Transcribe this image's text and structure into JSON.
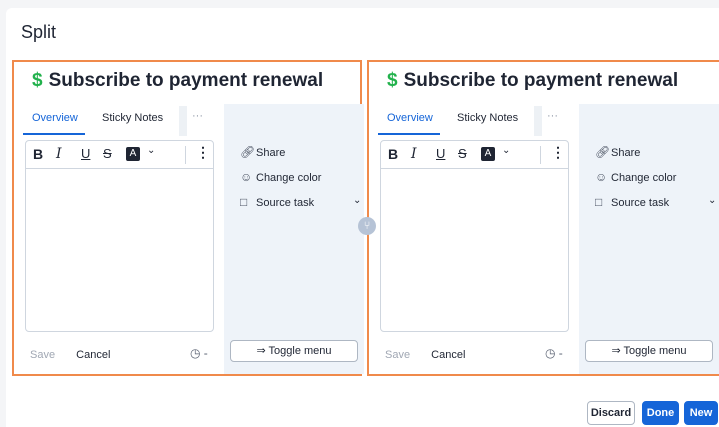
{
  "dialog": {
    "title": "Split"
  },
  "panels": [
    {
      "title": "Subscribe to payment renewal",
      "tabs": [
        "Overview",
        "Sticky Notes"
      ],
      "tab_more": "···",
      "toolbar": {
        "bold": "B",
        "italic": "I",
        "underline": "U",
        "strike": "S",
        "color": "A",
        "chevron": "⌄",
        "more": "⋮"
      },
      "save": "Save",
      "cancel": "Cancel",
      "clock": "◷ -",
      "menu": {
        "share": "Share",
        "change_color": "Change color",
        "source_task": "Source task"
      },
      "toggle": "⇒ Toggle menu"
    },
    {
      "title": "Subscribe to payment renewal",
      "tabs": [
        "Overview",
        "Sticky Notes"
      ],
      "tab_more": "···",
      "toolbar": {
        "bold": "B",
        "italic": "I",
        "underline": "U",
        "strike": "S",
        "color": "A",
        "chevron": "⌄",
        "more": "⋮"
      },
      "save": "Save",
      "cancel": "Cancel",
      "clock": "◷ -",
      "menu": {
        "share": "Share",
        "change_color": "Change color",
        "source_task": "Source task"
      },
      "toggle": "⇒ Toggle menu"
    }
  ],
  "icons": {
    "dollar": "$",
    "share": "link-icon",
    "palette": "palette-icon",
    "source": "task-icon",
    "split": "split-icon"
  },
  "buttons": {
    "discard": "Discard",
    "done": "Done",
    "new": "New"
  },
  "colors": {
    "accent": "#1565d8",
    "panel_border": "#f08a4b",
    "dollar": "#22b14c"
  }
}
